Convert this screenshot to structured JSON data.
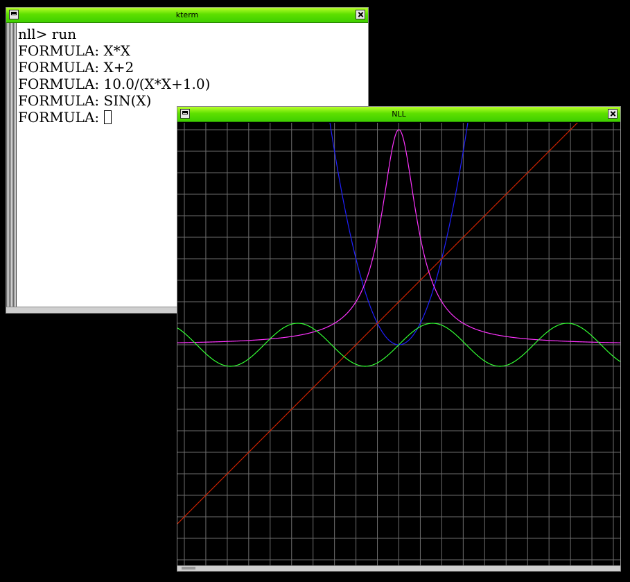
{
  "kterm": {
    "title": "kterm",
    "lines": [
      "nll> run",
      "FORMULA: X*X",
      "FORMULA: X+2",
      "FORMULA: 10.0/(X*X+1.0)",
      "FORMULA: SIN(X)",
      "FORMULA: "
    ]
  },
  "nll": {
    "title": "NLL"
  },
  "chart_data": {
    "type": "line",
    "title": "",
    "xlabel": "",
    "ylabel": "",
    "grid": true,
    "xlim": [
      -10,
      10
    ],
    "ylim": [
      -10,
      10
    ],
    "x_gridlines": 20,
    "y_gridlines": 20,
    "background": "#000000",
    "grid_color": "#6e6e6e",
    "series": [
      {
        "formula": "X*X",
        "color": "#2020ff"
      },
      {
        "formula": "X+2",
        "color": "#cc2200"
      },
      {
        "formula": "10.0/(X*X+1.0)",
        "color": "#ff33ff"
      },
      {
        "formula": "SIN(X)",
        "color": "#33ff33"
      }
    ]
  }
}
